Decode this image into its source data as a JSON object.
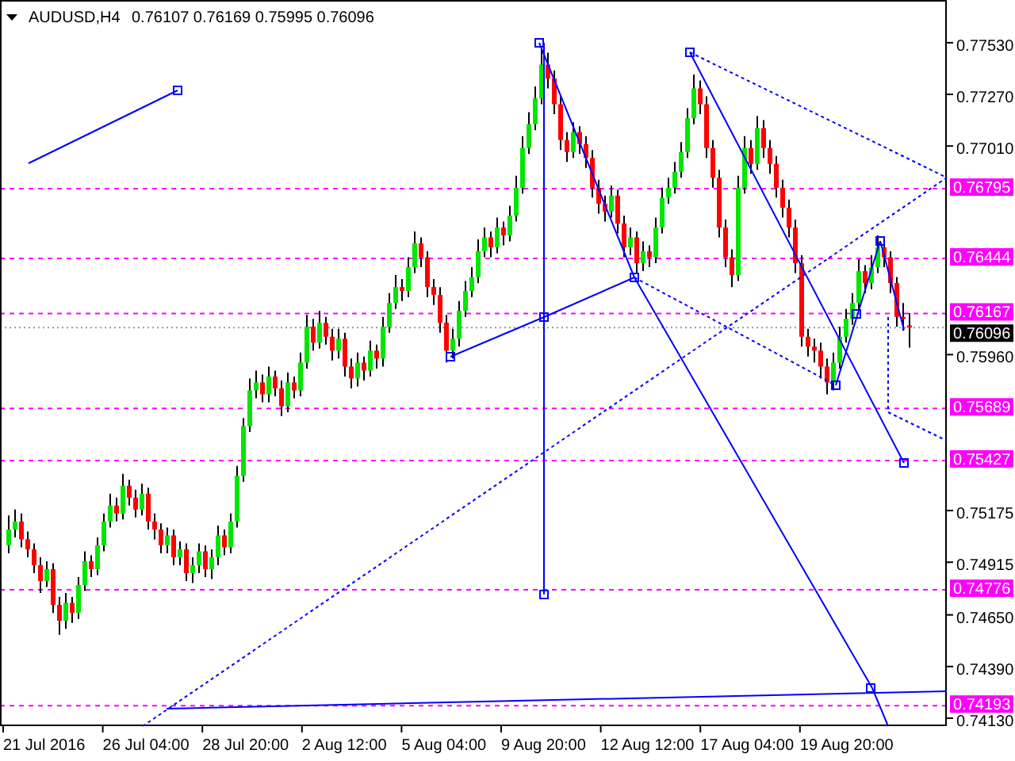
{
  "header": {
    "symbol": "AUDUSD,H4",
    "ohlc": "0.76107 0.76169 0.75995 0.76096"
  },
  "chart": {
    "chart_data": {
      "type": "candlestick",
      "ylim": [
        0.7409,
        0.77745
      ],
      "ref_lines": [
        {
          "axis": "y",
          "value": 0.76795,
          "label": "0.76795",
          "color": "#ff00ff"
        },
        {
          "axis": "y",
          "value": 0.76444,
          "label": "0.76444",
          "color": "#ff00ff"
        },
        {
          "axis": "y",
          "value": 0.76167,
          "label": "0.76167",
          "color": "#ff00ff"
        },
        {
          "axis": "y",
          "value": 0.75689,
          "label": "0.75689",
          "color": "#ff00ff"
        },
        {
          "axis": "y",
          "value": 0.75427,
          "label": "0.75427",
          "color": "#ff00ff"
        },
        {
          "axis": "y",
          "value": 0.74776,
          "label": "0.74776",
          "color": "#ff00ff"
        },
        {
          "axis": "y",
          "value": 0.74193,
          "label": "0.74193",
          "color": "#ff00ff"
        },
        {
          "axis": "y",
          "value": 0.76096,
          "label": "0.76096",
          "color": "#999999"
        }
      ],
      "yticks": [
        {
          "value": 0.7753,
          "label": "0.77530"
        },
        {
          "value": 0.7727,
          "label": "0.77270"
        },
        {
          "value": 0.7701,
          "label": "0.77010"
        },
        {
          "value": 0.7596,
          "label": "0.75960"
        },
        {
          "value": 0.75175,
          "label": "0.75175"
        },
        {
          "value": 0.74915,
          "label": "0.74915"
        },
        {
          "value": 0.7465,
          "label": "0.74650"
        },
        {
          "value": 0.7439,
          "label": "0.74390"
        },
        {
          "value": 0.7413,
          "label": "0.74130"
        }
      ],
      "ohlc": [
        [
          0.75,
          0.7515,
          0.7496,
          0.7508
        ],
        [
          0.7508,
          0.7518,
          0.7504,
          0.7512
        ],
        [
          0.7512,
          0.7516,
          0.7499,
          0.7503
        ],
        [
          0.7503,
          0.7507,
          0.7494,
          0.7498
        ],
        [
          0.7498,
          0.7501,
          0.7486,
          0.749
        ],
        [
          0.749,
          0.7494,
          0.7476,
          0.7482
        ],
        [
          0.7482,
          0.7492,
          0.7479,
          0.7488
        ],
        [
          0.7488,
          0.7491,
          0.7466,
          0.747
        ],
        [
          0.747,
          0.7474,
          0.7455,
          0.7462
        ],
        [
          0.7462,
          0.7476,
          0.7458,
          0.7471
        ],
        [
          0.7471,
          0.7474,
          0.7461,
          0.7466
        ],
        [
          0.7466,
          0.7484,
          0.7463,
          0.748
        ],
        [
          0.748,
          0.7497,
          0.7477,
          0.7492
        ],
        [
          0.7492,
          0.7495,
          0.7484,
          0.7488
        ],
        [
          0.7488,
          0.7504,
          0.7485,
          0.75
        ],
        [
          0.75,
          0.7516,
          0.7497,
          0.7512
        ],
        [
          0.7512,
          0.7526,
          0.7509,
          0.752
        ],
        [
          0.752,
          0.7524,
          0.7512,
          0.7516
        ],
        [
          0.7516,
          0.7536,
          0.7513,
          0.753
        ],
        [
          0.753,
          0.7533,
          0.752,
          0.7524
        ],
        [
          0.7524,
          0.7528,
          0.7514,
          0.7518
        ],
        [
          0.7518,
          0.7531,
          0.7515,
          0.7526
        ],
        [
          0.7526,
          0.7529,
          0.7508,
          0.7512
        ],
        [
          0.7512,
          0.7516,
          0.7503,
          0.7508
        ],
        [
          0.7508,
          0.7511,
          0.7496,
          0.75
        ],
        [
          0.75,
          0.7509,
          0.7496,
          0.7505
        ],
        [
          0.7505,
          0.7508,
          0.749,
          0.7494
        ],
        [
          0.7494,
          0.7502,
          0.749,
          0.7498
        ],
        [
          0.7498,
          0.7501,
          0.7482,
          0.7486
        ],
        [
          0.7486,
          0.7494,
          0.7481,
          0.749
        ],
        [
          0.749,
          0.7501,
          0.7486,
          0.7497
        ],
        [
          0.7497,
          0.75,
          0.7484,
          0.7488
        ],
        [
          0.7488,
          0.7498,
          0.7483,
          0.7494
        ],
        [
          0.7494,
          0.751,
          0.749,
          0.7505
        ],
        [
          0.7505,
          0.7508,
          0.7495,
          0.7499
        ],
        [
          0.7499,
          0.7516,
          0.7496,
          0.7512
        ],
        [
          0.7512,
          0.754,
          0.7509,
          0.7535
        ],
        [
          0.7535,
          0.7564,
          0.7532,
          0.756
        ],
        [
          0.756,
          0.7584,
          0.7557,
          0.7578
        ],
        [
          0.7578,
          0.7588,
          0.7574,
          0.7582
        ],
        [
          0.7582,
          0.7586,
          0.7572,
          0.7576
        ],
        [
          0.7576,
          0.759,
          0.7572,
          0.7585
        ],
        [
          0.7585,
          0.7588,
          0.7575,
          0.7579
        ],
        [
          0.7579,
          0.7583,
          0.7565,
          0.757
        ],
        [
          0.757,
          0.7587,
          0.7567,
          0.7582
        ],
        [
          0.7582,
          0.7585,
          0.7574,
          0.7578
        ],
        [
          0.7578,
          0.7597,
          0.7575,
          0.7592
        ],
        [
          0.7592,
          0.7616,
          0.7589,
          0.761
        ],
        [
          0.761,
          0.7614,
          0.7598,
          0.7602
        ],
        [
          0.7602,
          0.7618,
          0.7599,
          0.7612
        ],
        [
          0.7612,
          0.7615,
          0.7601,
          0.7605
        ],
        [
          0.7605,
          0.7609,
          0.7593,
          0.7598
        ],
        [
          0.7598,
          0.7609,
          0.7594,
          0.7604
        ],
        [
          0.7604,
          0.7607,
          0.7585,
          0.759
        ],
        [
          0.759,
          0.7594,
          0.7579,
          0.7584
        ],
        [
          0.7584,
          0.7597,
          0.758,
          0.7592
        ],
        [
          0.7592,
          0.7595,
          0.7583,
          0.7588
        ],
        [
          0.7588,
          0.7603,
          0.7585,
          0.7598
        ],
        [
          0.7598,
          0.7601,
          0.7589,
          0.7594
        ],
        [
          0.7594,
          0.7615,
          0.759,
          0.761
        ],
        [
          0.761,
          0.7627,
          0.7607,
          0.7622
        ],
        [
          0.7622,
          0.7636,
          0.7619,
          0.763
        ],
        [
          0.763,
          0.7634,
          0.7623,
          0.7628
        ],
        [
          0.7628,
          0.7645,
          0.7625,
          0.764
        ],
        [
          0.764,
          0.7658,
          0.7637,
          0.7652
        ],
        [
          0.7652,
          0.7655,
          0.764,
          0.7645
        ],
        [
          0.7645,
          0.7648,
          0.7625,
          0.763
        ],
        [
          0.763,
          0.7634,
          0.7621,
          0.7626
        ],
        [
          0.7626,
          0.763,
          0.7607,
          0.7612
        ],
        [
          0.7612,
          0.7616,
          0.7592,
          0.7598
        ],
        [
          0.7598,
          0.7609,
          0.7594,
          0.7604
        ],
        [
          0.7604,
          0.7623,
          0.76,
          0.7618
        ],
        [
          0.7618,
          0.7633,
          0.7615,
          0.7628
        ],
        [
          0.7628,
          0.764,
          0.7625,
          0.7635
        ],
        [
          0.7635,
          0.7654,
          0.7632,
          0.7648
        ],
        [
          0.7648,
          0.766,
          0.7645,
          0.7655
        ],
        [
          0.7655,
          0.7658,
          0.7645,
          0.765
        ],
        [
          0.765,
          0.7665,
          0.7647,
          0.766
        ],
        [
          0.766,
          0.7663,
          0.7651,
          0.7656
        ],
        [
          0.7656,
          0.7671,
          0.7653,
          0.7666
        ],
        [
          0.7666,
          0.7686,
          0.7663,
          0.768
        ],
        [
          0.768,
          0.7706,
          0.7677,
          0.77
        ],
        [
          0.77,
          0.7718,
          0.7697,
          0.7712
        ],
        [
          0.7712,
          0.7731,
          0.7709,
          0.7725
        ],
        [
          0.7725,
          0.775,
          0.7722,
          0.7742
        ],
        [
          0.7742,
          0.7748,
          0.773,
          0.7735
        ],
        [
          0.7735,
          0.7739,
          0.7717,
          0.7722
        ],
        [
          0.7722,
          0.7726,
          0.7699,
          0.7704
        ],
        [
          0.7704,
          0.7708,
          0.7693,
          0.7698
        ],
        [
          0.7698,
          0.7713,
          0.7695,
          0.7708
        ],
        [
          0.7708,
          0.7711,
          0.7697,
          0.7702
        ],
        [
          0.7702,
          0.7706,
          0.769,
          0.7695
        ],
        [
          0.7695,
          0.7699,
          0.7675,
          0.768
        ],
        [
          0.768,
          0.7684,
          0.7667,
          0.7672
        ],
        [
          0.7672,
          0.7676,
          0.7663,
          0.7668
        ],
        [
          0.7668,
          0.7681,
          0.7665,
          0.7676
        ],
        [
          0.7676,
          0.7679,
          0.7657,
          0.7662
        ],
        [
          0.7662,
          0.7666,
          0.7645,
          0.765
        ],
        [
          0.765,
          0.766,
          0.7646,
          0.7655
        ],
        [
          0.7655,
          0.7658,
          0.7637,
          0.7642
        ],
        [
          0.7642,
          0.7653,
          0.7638,
          0.7648
        ],
        [
          0.7648,
          0.7651,
          0.764,
          0.7645
        ],
        [
          0.7645,
          0.7665,
          0.7642,
          0.766
        ],
        [
          0.766,
          0.768,
          0.7657,
          0.7675
        ],
        [
          0.7675,
          0.7685,
          0.7672,
          0.768
        ],
        [
          0.768,
          0.7693,
          0.7677,
          0.7688
        ],
        [
          0.7688,
          0.7703,
          0.7685,
          0.7698
        ],
        [
          0.7698,
          0.772,
          0.7695,
          0.7715
        ],
        [
          0.7715,
          0.7737,
          0.7712,
          0.773
        ],
        [
          0.773,
          0.7734,
          0.7717,
          0.7722
        ],
        [
          0.7722,
          0.7726,
          0.7695,
          0.77
        ],
        [
          0.77,
          0.7704,
          0.768,
          0.7685
        ],
        [
          0.7685,
          0.7689,
          0.7655,
          0.766
        ],
        [
          0.766,
          0.7664,
          0.764,
          0.7645
        ],
        [
          0.7645,
          0.7649,
          0.763,
          0.7636
        ],
        [
          0.7636,
          0.7686,
          0.7633,
          0.768
        ],
        [
          0.768,
          0.7706,
          0.7677,
          0.77
        ],
        [
          0.77,
          0.7704,
          0.7687,
          0.7692
        ],
        [
          0.7692,
          0.7716,
          0.7689,
          0.771
        ],
        [
          0.771,
          0.7714,
          0.7695,
          0.77
        ],
        [
          0.77,
          0.7704,
          0.7687,
          0.7692
        ],
        [
          0.7692,
          0.7696,
          0.7675,
          0.768
        ],
        [
          0.768,
          0.7684,
          0.7665,
          0.767
        ],
        [
          0.767,
          0.7674,
          0.7655,
          0.766
        ],
        [
          0.766,
          0.7664,
          0.7637,
          0.7642
        ],
        [
          0.7642,
          0.7646,
          0.76,
          0.7605
        ],
        [
          0.7605,
          0.7609,
          0.7595,
          0.76
        ],
        [
          0.76,
          0.7604,
          0.7592,
          0.7598
        ],
        [
          0.7598,
          0.7602,
          0.7584,
          0.759
        ],
        [
          0.759,
          0.7594,
          0.7576,
          0.7582
        ],
        [
          0.7582,
          0.7597,
          0.7578,
          0.7592
        ],
        [
          0.7592,
          0.761,
          0.7589,
          0.7605
        ],
        [
          0.7605,
          0.7619,
          0.7602,
          0.7614
        ],
        [
          0.7614,
          0.7627,
          0.7611,
          0.7622
        ],
        [
          0.7622,
          0.7644,
          0.7619,
          0.7638
        ],
        [
          0.7638,
          0.7641,
          0.7627,
          0.7632
        ],
        [
          0.7632,
          0.7646,
          0.7629,
          0.764
        ],
        [
          0.764,
          0.7656,
          0.7637,
          0.765
        ],
        [
          0.765,
          0.7653,
          0.764,
          0.7645
        ],
        [
          0.7645,
          0.7648,
          0.7627,
          0.7632
        ],
        [
          0.7632,
          0.7635,
          0.761,
          0.7615
        ],
        [
          0.7615,
          0.7622,
          0.7608,
          0.7614
        ],
        [
          0.76107,
          0.76169,
          0.75995,
          0.76096
        ]
      ]
    }
  },
  "time_axis": {
    "labels": [
      "21 Jul 2016",
      "26 Jul 04:00",
      "28 Jul 20:00",
      "2 Aug 12:00",
      "5 Aug 04:00",
      "9 Aug 20:00",
      "12 Aug 12:00",
      "17 Aug 04:00",
      "19 Aug 20:00"
    ]
  }
}
